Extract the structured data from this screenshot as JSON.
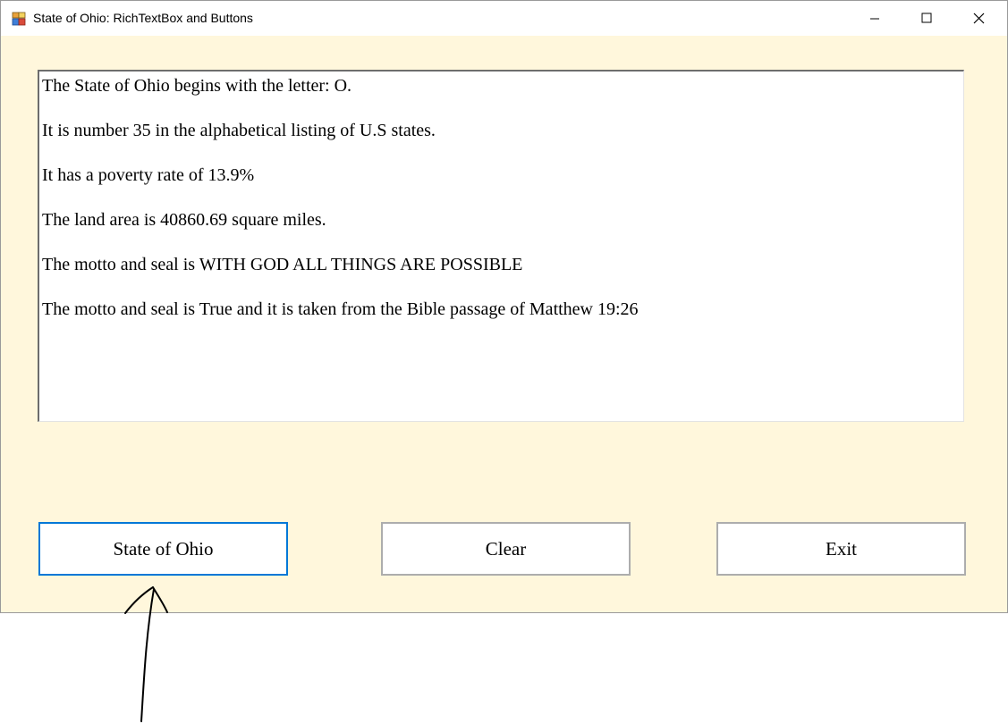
{
  "window": {
    "title": "State of Ohio: RichTextBox and Buttons",
    "icon": "winforms-app-icon"
  },
  "titlebar_controls": {
    "minimize": "minimize-icon",
    "maximize": "maximize-icon",
    "close": "close-icon"
  },
  "richtextbox": {
    "lines": [
      "The State of Ohio begins with the letter: O.",
      "It is number 35 in the alphabetical listing of U.S states.",
      "It has a poverty rate of 13.9%",
      "The land area is 40860.69 square miles.",
      "The motto and seal is WITH GOD ALL THINGS ARE POSSIBLE",
      "The motto and seal is True and it is taken from the Bible passage of Matthew 19:26"
    ]
  },
  "buttons": {
    "state_of_ohio": "State of Ohio",
    "clear": "Clear",
    "exit": "Exit"
  },
  "colors": {
    "form_background": "#fff7dc",
    "focused_button_border": "#0078d7"
  },
  "annotation": "hand-drawn-arrow-pointing-up"
}
